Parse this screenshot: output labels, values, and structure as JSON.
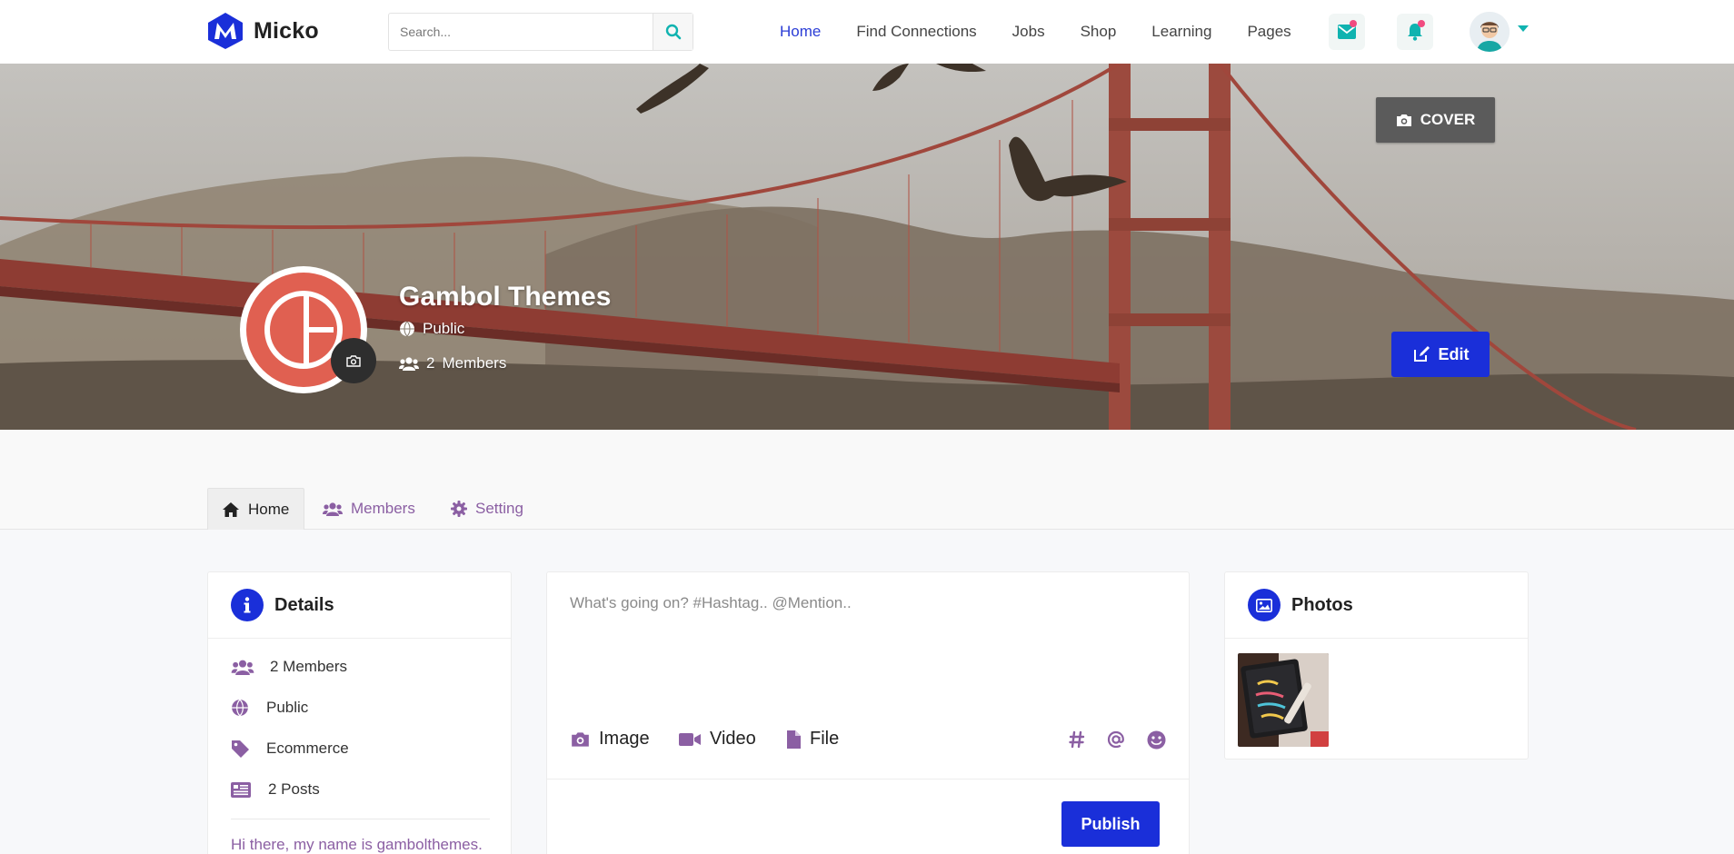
{
  "navbar": {
    "brand": "Micko",
    "search_placeholder": "Search...",
    "links": [
      "Home",
      "Find Connections",
      "Jobs",
      "Shop",
      "Learning",
      "Pages"
    ],
    "active_link": "Home",
    "icons": [
      "envelope-icon",
      "bell-icon",
      "avatar",
      "caret-down-icon"
    ]
  },
  "cover": {
    "cover_button": "COVER",
    "edit_button": "Edit"
  },
  "group": {
    "name": "Gambol Themes",
    "privacy": "Public",
    "members_count": "2",
    "members_label": "Members"
  },
  "tabs": [
    "Home",
    "Members",
    "Setting"
  ],
  "details": {
    "title": "Details",
    "members": "2 Members",
    "privacy": "Public",
    "category": "Ecommerce",
    "posts": "2 Posts",
    "bio": "Hi there, my name is gambolthemes."
  },
  "composer": {
    "placeholder": "What's going on? #Hashtag.. @Mention..",
    "actions": [
      "Image",
      "Video",
      "File"
    ],
    "tools": [
      "hashtag-icon",
      "at-icon",
      "smile-icon"
    ],
    "publish": "Publish"
  },
  "photos": {
    "title": "Photos",
    "items": [
      "photo-thumb"
    ]
  },
  "colors": {
    "primary": "#1a2fd9",
    "accent_teal": "#10b3b0",
    "purple": "#8b5fa3",
    "notification_dot": "#f14b80"
  }
}
